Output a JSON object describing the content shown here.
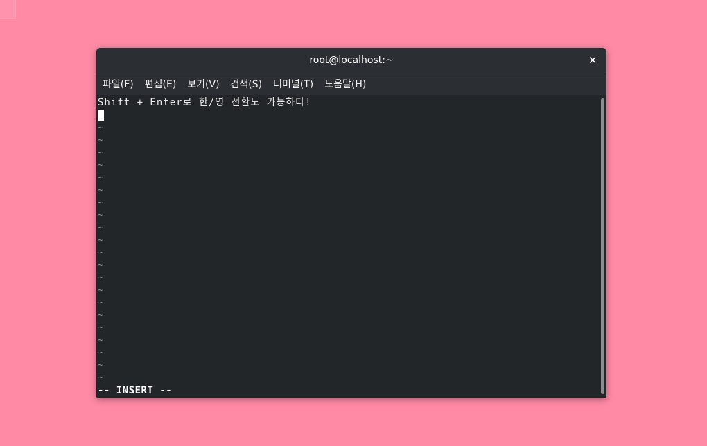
{
  "window": {
    "title": "root@localhost:~",
    "close_glyph": "✕"
  },
  "menu": [
    {
      "label": "파일(F)"
    },
    {
      "label": "편집(E)"
    },
    {
      "label": "보기(V)"
    },
    {
      "label": "검색(S)"
    },
    {
      "label": "터미널(T)"
    },
    {
      "label": "도움말(H)"
    }
  ],
  "terminal": {
    "first_line": "Shift + Enter로 한/영 전환도 가능하다!",
    "tilde": "~",
    "tilde_count": 21,
    "mode": "-- INSERT --"
  },
  "colors": {
    "desktop": "#ff8aa6",
    "terminal_bg": "#232629",
    "titlebar_bg": "#2b2e32"
  }
}
